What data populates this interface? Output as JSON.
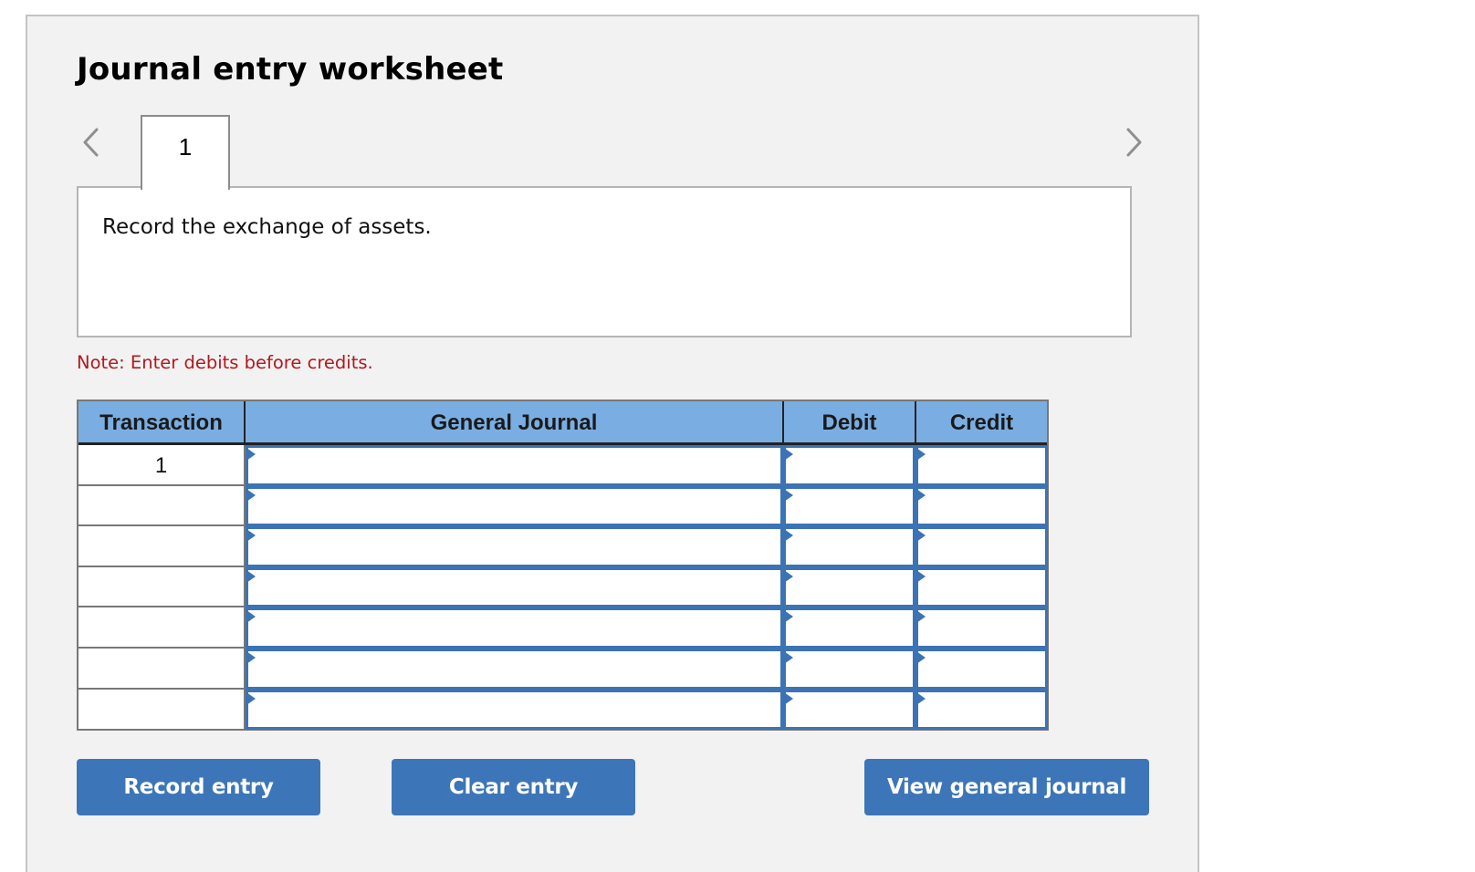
{
  "worksheet": {
    "title": "Journal entry worksheet",
    "nav": {
      "prev_icon": "chevron-left-icon",
      "next_icon": "chevron-right-icon"
    },
    "tabs": [
      {
        "label": "1",
        "active": true
      }
    ],
    "description": "Record the exchange of assets.",
    "note": "Note: Enter debits before credits.",
    "note_color": "#b0191e"
  },
  "table": {
    "columns": [
      "Transaction",
      "General Journal",
      "Debit",
      "Credit"
    ],
    "header_color": "#7aaee2",
    "input_border_color": "#3c73b4",
    "rows": [
      {
        "transaction": "1",
        "general_journal": "",
        "debit": "",
        "credit": ""
      },
      {
        "transaction": "",
        "general_journal": "",
        "debit": "",
        "credit": ""
      },
      {
        "transaction": "",
        "general_journal": "",
        "debit": "",
        "credit": ""
      },
      {
        "transaction": "",
        "general_journal": "",
        "debit": "",
        "credit": ""
      },
      {
        "transaction": "",
        "general_journal": "",
        "debit": "",
        "credit": ""
      },
      {
        "transaction": "",
        "general_journal": "",
        "debit": "",
        "credit": ""
      },
      {
        "transaction": "",
        "general_journal": "",
        "debit": "",
        "credit": ""
      }
    ]
  },
  "buttons": {
    "record_entry": "Record entry",
    "clear_entry": "Clear entry",
    "view_general_journal": "View general journal",
    "color": "#3d76b8"
  }
}
